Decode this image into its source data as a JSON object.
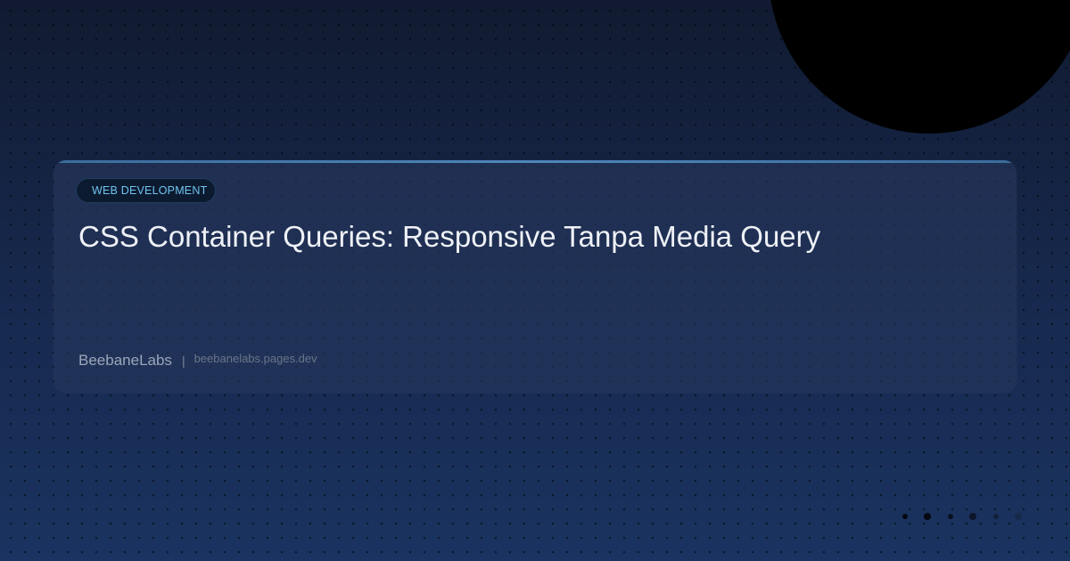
{
  "card": {
    "category": "WEB DEVELOPMENT",
    "title": "CSS Container Queries: Responsive Tanpa Media Query",
    "brand": "BeebaneLabs",
    "divider": "|",
    "url": "beebanelabs.pages.dev"
  },
  "colors": {
    "background_top": "#111a30",
    "background_bottom": "#1a3360",
    "card": "#26375c",
    "accent": "#4e86ba",
    "badge_text": "#6fc4ef",
    "title_text": "#eef1f6"
  },
  "icons": {
    "decoration": "black-circle",
    "indicator": "dot"
  }
}
